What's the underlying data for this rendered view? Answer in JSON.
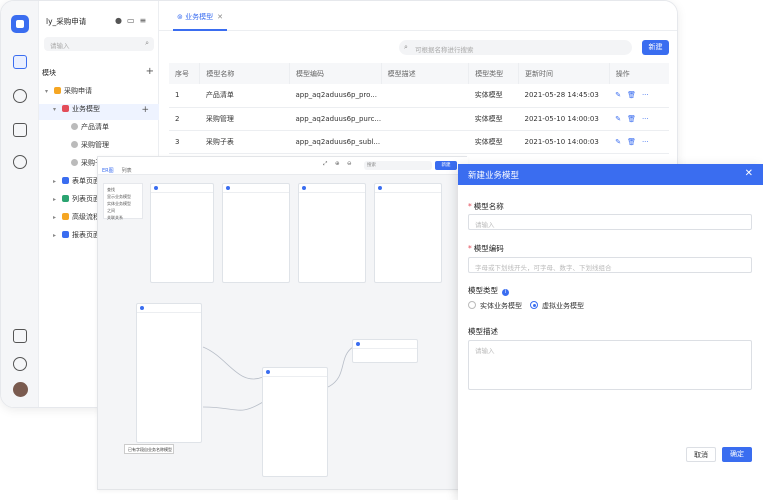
{
  "tree": {
    "title": "ly_采购申请",
    "search_placeholder": "请输入",
    "module_header": "模块",
    "nodes": [
      {
        "label": "采购申请",
        "icon_color": "#f5a623"
      },
      {
        "label": "业务模型",
        "icon_color": "#e34d59"
      },
      {
        "label": "产品清单",
        "icon_color": "#999999"
      },
      {
        "label": "采购管理",
        "icon_color": "#999999"
      },
      {
        "label": "采购子表",
        "icon_color": "#999999"
      },
      {
        "label": "表单页面",
        "icon_color": "#3a6df0"
      },
      {
        "label": "列表页面",
        "icon_color": "#2ba471"
      },
      {
        "label": "高级流程",
        "icon_color": "#f5a623"
      },
      {
        "label": "报表页面",
        "icon_color": "#3a6df0"
      }
    ]
  },
  "main": {
    "tab_label": "业务模型",
    "search_placeholder": "可根据名称进行搜索",
    "new_button": "新建",
    "columns": [
      "序号",
      "模型名称",
      "模型编码",
      "模型描述",
      "模型类型",
      "更新时间",
      "操作"
    ],
    "rows": [
      {
        "idx": "1",
        "name": "产品清单",
        "code": "app_aq2aduus6p_pro...",
        "desc": "",
        "type": "实体模型",
        "time": "2021-05-28 14:45:03"
      },
      {
        "idx": "2",
        "name": "采购管理",
        "code": "app_aq2aduus6p_purc...",
        "desc": "",
        "type": "实体模型",
        "time": "2021-05-10 14:00:03"
      },
      {
        "idx": "3",
        "name": "采购子表",
        "code": "app_aq2aduus6p_subl...",
        "desc": "",
        "type": "实体模型",
        "time": "2021-05-10 14:00:03"
      }
    ]
  },
  "canvas": {
    "tabs": [
      "ER图",
      "列表"
    ],
    "search_placeholder": "搜索",
    "new_button": "新建",
    "panel_items": [
      "查找",
      "显示业务模型",
      "实体业务模型",
      "之间",
      "关联关系"
    ],
    "tooltip": "已有字段自业务名称模型"
  },
  "dialog": {
    "title": "新建业务模型",
    "name_label": "模型名称",
    "name_placeholder": "请输入",
    "code_label": "模型编码",
    "code_placeholder": "字母或下划线开头，可字母、数字、下划线组合",
    "type_label": "模型类型",
    "type_options": [
      "实体业务模型",
      "虚拟业务模型"
    ],
    "selected_type": "虚拟业务模型",
    "desc_label": "模型描述",
    "desc_placeholder": "请输入",
    "cancel": "取消",
    "ok": "确定"
  }
}
